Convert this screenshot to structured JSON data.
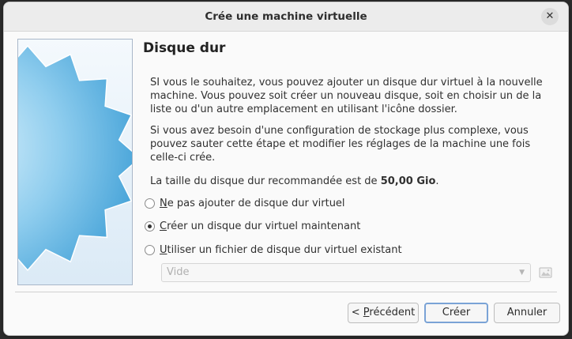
{
  "window": {
    "title": "Crée une machine virtuelle"
  },
  "page": {
    "heading": "Disque dur",
    "para1": "SI vous le souhaitez, vous pouvez ajouter un disque dur virtuel à la nouvelle machine. Vous pouvez soit créer un nouveau disque, soit en choisir un de la liste ou d'un autre emplacement en utilisant l'icône dossier.",
    "para2": "Si vous avez besoin d'une configuration de stockage plus complexe, vous pouvez sauter cette étape et modifier les réglages de la machine une fois celle-ci crée.",
    "recommended_prefix": "La taille du disque dur recommandée est de ",
    "recommended_size": "50,00 Gio",
    "recommended_suffix": "."
  },
  "options": [
    {
      "mnemonic": "N",
      "rest": "e pas ajouter de disque dur virtuel",
      "selected": false
    },
    {
      "mnemonic": "C",
      "rest": "réer un disque dur virtuel maintenant",
      "selected": true
    },
    {
      "mnemonic": "U",
      "rest": "tiliser un fichier de disque dur virtuel existant",
      "selected": false
    }
  ],
  "disk_select": {
    "value": "Vide",
    "enabled": false
  },
  "buttons": {
    "previous_prefix": "< ",
    "previous_mnemonic": "P",
    "previous_rest": "récédent",
    "create": "Créer",
    "cancel": "Annuler"
  },
  "icons": {
    "close": "close-icon",
    "folder": "folder-open-icon",
    "dropdown": "chevron-down-icon"
  }
}
